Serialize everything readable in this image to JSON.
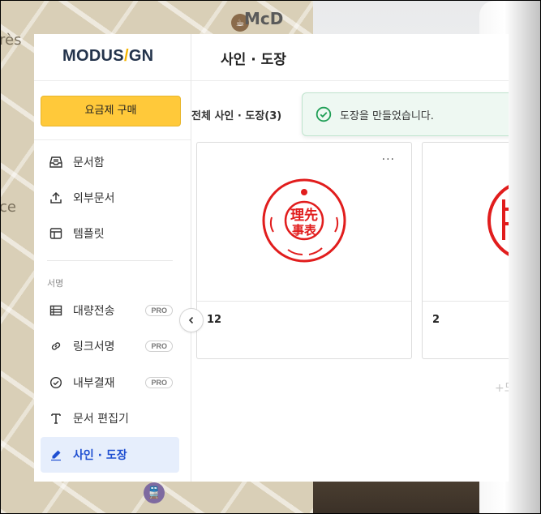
{
  "background": {
    "map_words": [
      "rès",
      "ce"
    ],
    "map_store": "McD"
  },
  "sidebar": {
    "logo_left": "MODUS",
    "logo_slash": "/",
    "logo_right": "GN",
    "buy_button": "요금제 구매",
    "items": [
      {
        "label": "문서함",
        "icon": "inbox-icon"
      },
      {
        "label": "외부문서",
        "icon": "upload-icon"
      },
      {
        "label": "템플릿",
        "icon": "template-icon"
      }
    ],
    "section_label": "서명",
    "sign_items": [
      {
        "label": "대량전송",
        "icon": "table-icon",
        "badge": "PRO"
      },
      {
        "label": "링크서명",
        "icon": "link-icon",
        "badge": "PRO"
      },
      {
        "label": "내부결재",
        "icon": "check-circle-icon",
        "badge": "PRO"
      },
      {
        "label": "문서 편집기",
        "icon": "text-icon"
      },
      {
        "label": "사인 · 도장",
        "icon": "pen-icon",
        "active": true
      }
    ]
  },
  "main": {
    "title": "사인 · 도장",
    "count_label": "전체 사인 · 도장(3)",
    "toast": "도장을 만들었습니다.",
    "cards": [
      {
        "name": "12",
        "stamp_top": "理先",
        "stamp_bottom": "事表"
      },
      {
        "name": "2"
      }
    ],
    "add_hint": "+도"
  },
  "colors": {
    "accent": "#ffc93a",
    "active_bg": "#e6eefc",
    "active_text": "#1f4fd1",
    "stamp_red": "#e11d1d",
    "toast_bg": "#eef8f2",
    "toast_icon": "#1e9e55"
  }
}
